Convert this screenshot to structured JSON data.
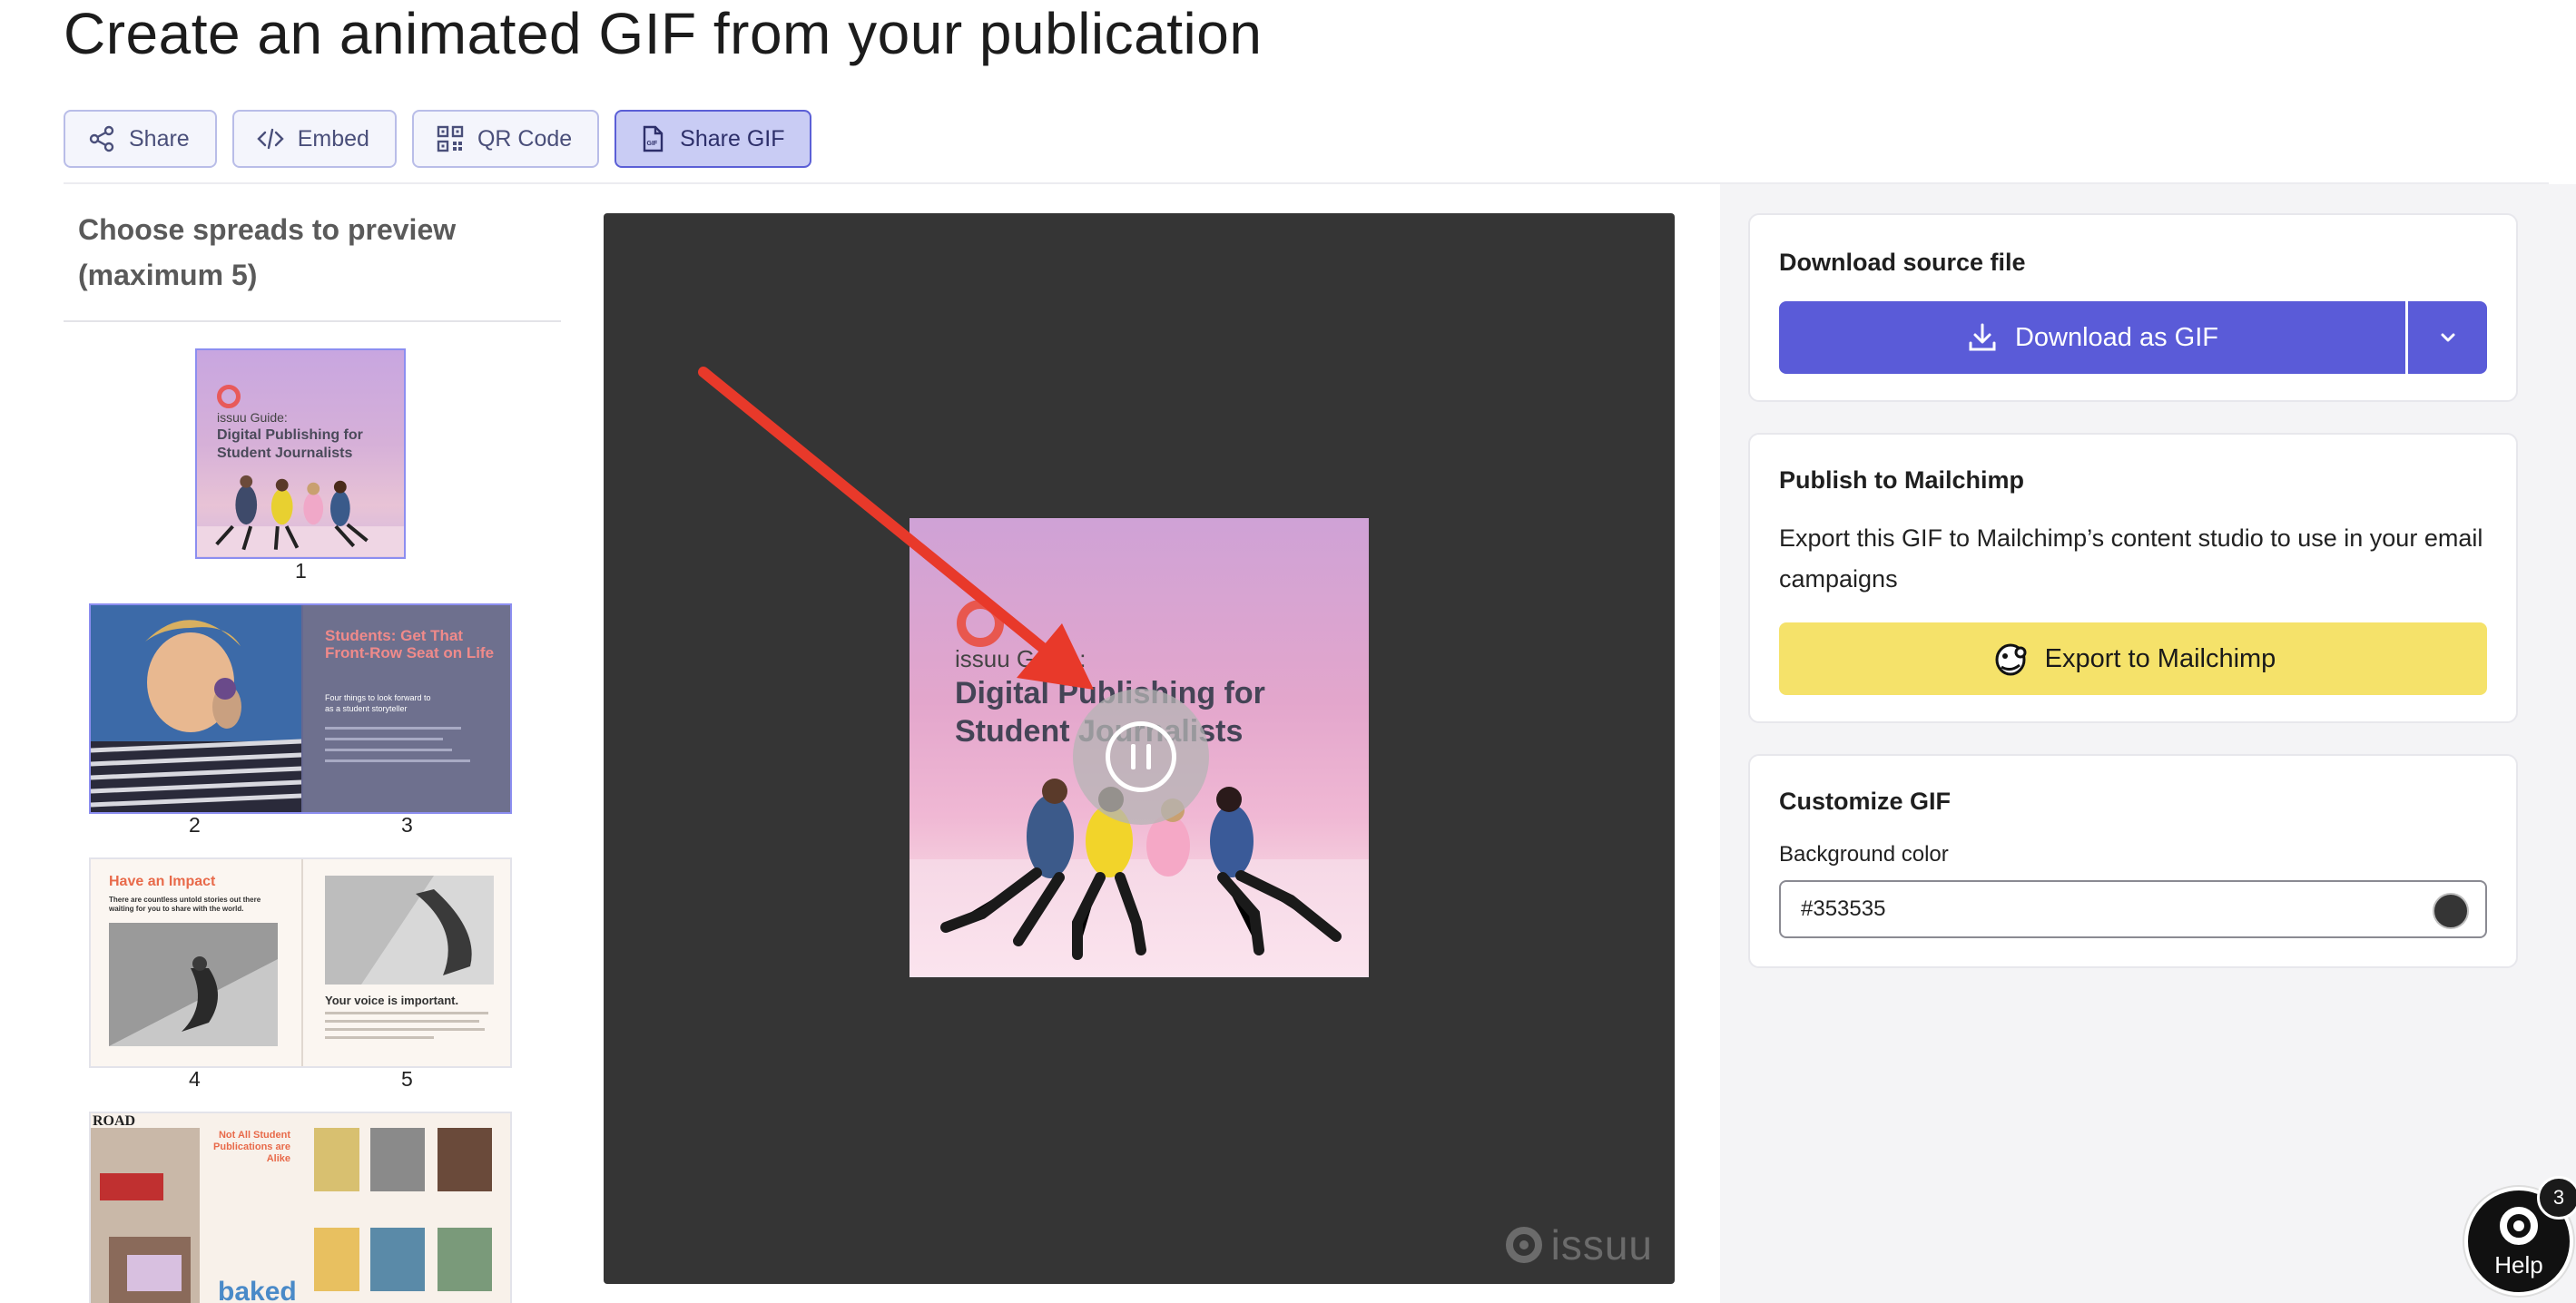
{
  "page": {
    "title": "Create an animated GIF from your publication"
  },
  "tabs": [
    {
      "label": "Share",
      "icon": "share-icon",
      "active": false
    },
    {
      "label": "Embed",
      "icon": "code-icon",
      "active": false
    },
    {
      "label": "QR Code",
      "icon": "qr-code-icon",
      "active": false
    },
    {
      "label": "Share GIF",
      "icon": "gif-file-icon",
      "active": true
    }
  ],
  "spreads": {
    "heading": "Choose spreads to preview (maximum 5)",
    "pages": [
      "1",
      "2",
      "3",
      "4",
      "5"
    ],
    "cover": {
      "brand": "issuu Guide:",
      "title": "Digital Publishing for Student Journalists"
    },
    "spread_2_3": {
      "title": "Students: Get That Front-Row Seat on Life",
      "subtitle": "Four things to look forward to as a student storyteller"
    },
    "spread_4_5": {
      "left_title": "Have an Impact",
      "left_text": "There are countless untold stories out there waiting for you to share with the world.",
      "right_title": "Your voice is important."
    },
    "spread_6_7": {
      "left_title": "Not All Student Publications are Alike",
      "masthead": "ROAD",
      "sticker": "baked"
    }
  },
  "preview": {
    "cover": {
      "brand": "issuu Guide:",
      "title": "Digital Publishing for Student Journalists"
    },
    "watermark": "issuu",
    "background_color": "#353535"
  },
  "download": {
    "title": "Download source file",
    "button_label": "Download as GIF"
  },
  "mailchimp": {
    "title": "Publish to Mailchimp",
    "description": "Export this GIF to Mailchimp’s content studio to use in your email campaigns",
    "button_label": "Export to Mailchimp"
  },
  "customize": {
    "title": "Customize GIF",
    "bg_label": "Background color",
    "bg_value": "#353535"
  },
  "help": {
    "label": "Help",
    "badge": "3"
  },
  "colors": {
    "accent": "#5a5bd8",
    "mailchimp": "#f5e26a",
    "annotation_arrow": "#e8392a"
  }
}
